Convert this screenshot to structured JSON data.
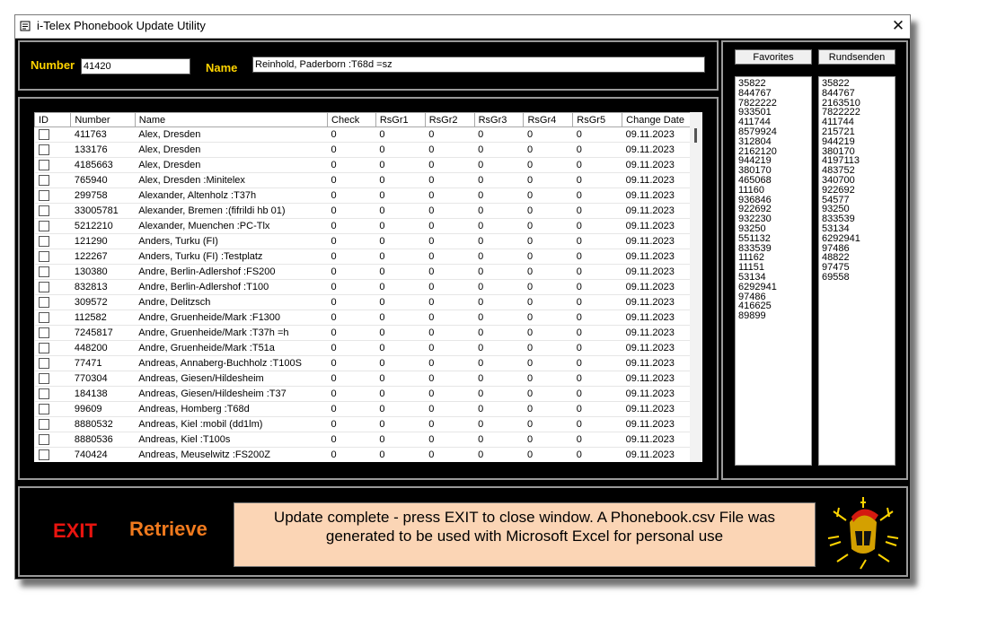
{
  "window": {
    "title": "i-Telex Phonebook Update Utility"
  },
  "top": {
    "number_label": "Number",
    "number_value": "41420",
    "name_label": "Name",
    "name_value": "Reinhold, Paderborn :T68d =sz"
  },
  "table": {
    "columns": [
      "ID",
      "Number",
      "Name",
      "Check",
      "RsGr1",
      "RsGr2",
      "RsGr3",
      "RsGr4",
      "RsGr5",
      "Change Date"
    ],
    "rows": [
      {
        "number": "411763",
        "name": "Alex, Dresden",
        "check": "0",
        "rs1": "0",
        "rs2": "0",
        "rs3": "0",
        "rs4": "0",
        "rs5": "0",
        "date": "09.11.2023"
      },
      {
        "number": "133176",
        "name": "Alex, Dresden",
        "check": "0",
        "rs1": "0",
        "rs2": "0",
        "rs3": "0",
        "rs4": "0",
        "rs5": "0",
        "date": "09.11.2023"
      },
      {
        "number": "4185663",
        "name": "Alex, Dresden",
        "check": "0",
        "rs1": "0",
        "rs2": "0",
        "rs3": "0",
        "rs4": "0",
        "rs5": "0",
        "date": "09.11.2023"
      },
      {
        "number": "765940",
        "name": "Alex, Dresden :Minitelex",
        "check": "0",
        "rs1": "0",
        "rs2": "0",
        "rs3": "0",
        "rs4": "0",
        "rs5": "0",
        "date": "09.11.2023"
      },
      {
        "number": "299758",
        "name": "Alexander, Altenholz :T37h",
        "check": "0",
        "rs1": "0",
        "rs2": "0",
        "rs3": "0",
        "rs4": "0",
        "rs5": "0",
        "date": "09.11.2023"
      },
      {
        "number": "33005781",
        "name": "Alexander, Bremen :(fifrildi hb 01)",
        "check": "0",
        "rs1": "0",
        "rs2": "0",
        "rs3": "0",
        "rs4": "0",
        "rs5": "0",
        "date": "09.11.2023"
      },
      {
        "number": "5212210",
        "name": "Alexander, Muenchen :PC-Tlx",
        "check": "0",
        "rs1": "0",
        "rs2": "0",
        "rs3": "0",
        "rs4": "0",
        "rs5": "0",
        "date": "09.11.2023"
      },
      {
        "number": "121290",
        "name": "Anders, Turku (FI)",
        "check": "0",
        "rs1": "0",
        "rs2": "0",
        "rs3": "0",
        "rs4": "0",
        "rs5": "0",
        "date": "09.11.2023"
      },
      {
        "number": "122267",
        "name": "Anders, Turku (FI) :Testplatz",
        "check": "0",
        "rs1": "0",
        "rs2": "0",
        "rs3": "0",
        "rs4": "0",
        "rs5": "0",
        "date": "09.11.2023"
      },
      {
        "number": "130380",
        "name": "Andre, Berlin-Adlershof :FS200",
        "check": "0",
        "rs1": "0",
        "rs2": "0",
        "rs3": "0",
        "rs4": "0",
        "rs5": "0",
        "date": "09.11.2023"
      },
      {
        "number": "832813",
        "name": "Andre, Berlin-Adlershof :T100",
        "check": "0",
        "rs1": "0",
        "rs2": "0",
        "rs3": "0",
        "rs4": "0",
        "rs5": "0",
        "date": "09.11.2023"
      },
      {
        "number": "309572",
        "name": "Andre, Delitzsch",
        "check": "0",
        "rs1": "0",
        "rs2": "0",
        "rs3": "0",
        "rs4": "0",
        "rs5": "0",
        "date": "09.11.2023"
      },
      {
        "number": "112582",
        "name": "Andre, Gruenheide/Mark :F1300",
        "check": "0",
        "rs1": "0",
        "rs2": "0",
        "rs3": "0",
        "rs4": "0",
        "rs5": "0",
        "date": "09.11.2023"
      },
      {
        "number": "7245817",
        "name": "Andre, Gruenheide/Mark :T37h =h",
        "check": "0",
        "rs1": "0",
        "rs2": "0",
        "rs3": "0",
        "rs4": "0",
        "rs5": "0",
        "date": "09.11.2023"
      },
      {
        "number": "448200",
        "name": "Andre, Gruenheide/Mark :T51a",
        "check": "0",
        "rs1": "0",
        "rs2": "0",
        "rs3": "0",
        "rs4": "0",
        "rs5": "0",
        "date": "09.11.2023"
      },
      {
        "number": "77471",
        "name": "Andreas, Annaberg-Buchholz :T100S",
        "check": "0",
        "rs1": "0",
        "rs2": "0",
        "rs3": "0",
        "rs4": "0",
        "rs5": "0",
        "date": "09.11.2023"
      },
      {
        "number": "770304",
        "name": "Andreas, Giesen/Hildesheim",
        "check": "0",
        "rs1": "0",
        "rs2": "0",
        "rs3": "0",
        "rs4": "0",
        "rs5": "0",
        "date": "09.11.2023"
      },
      {
        "number": "184138",
        "name": "Andreas, Giesen/Hildesheim :T37",
        "check": "0",
        "rs1": "0",
        "rs2": "0",
        "rs3": "0",
        "rs4": "0",
        "rs5": "0",
        "date": "09.11.2023"
      },
      {
        "number": "99609",
        "name": "Andreas, Homberg :T68d",
        "check": "0",
        "rs1": "0",
        "rs2": "0",
        "rs3": "0",
        "rs4": "0",
        "rs5": "0",
        "date": "09.11.2023"
      },
      {
        "number": "8880532",
        "name": "Andreas, Kiel :mobil (dd1lm)",
        "check": "0",
        "rs1": "0",
        "rs2": "0",
        "rs3": "0",
        "rs4": "0",
        "rs5": "0",
        "date": "09.11.2023"
      },
      {
        "number": "8880536",
        "name": "Andreas, Kiel :T100s",
        "check": "0",
        "rs1": "0",
        "rs2": "0",
        "rs3": "0",
        "rs4": "0",
        "rs5": "0",
        "date": "09.11.2023"
      },
      {
        "number": "740424",
        "name": "Andreas, Meuselwitz :FS200Z",
        "check": "0",
        "rs1": "0",
        "rs2": "0",
        "rs3": "0",
        "rs4": "0",
        "rs5": "0",
        "date": "09.11.2023"
      }
    ]
  },
  "favorites": {
    "label": "Favorites",
    "items": [
      "35822",
      "844767",
      "7822222",
      "933501",
      "411744",
      "8579924",
      "312804",
      "2162120",
      "944219",
      "380170",
      "465068",
      "11160",
      "936846",
      "922692",
      "932230",
      "93250",
      "551132",
      "833539",
      "11162",
      "11151",
      "53134",
      "6292941",
      "97486",
      "416625",
      "89899"
    ]
  },
  "rundsenden": {
    "label": "Rundsenden",
    "items": [
      "35822",
      "844767",
      "2163510",
      "7822222",
      "411744",
      "215721",
      "944219",
      "380170",
      "4197113",
      "483752",
      "340700",
      "922692",
      "54577",
      "93250",
      "833539",
      "53134",
      "6292941",
      "97486",
      "48822",
      "97475",
      "69558"
    ]
  },
  "bottom": {
    "exit_label": "EXIT",
    "retrieve_label": "Retrieve",
    "status": "Update complete - press EXIT to close window. A Phonebook.csv File was generated to be used with Microsoft Excel for personal use"
  },
  "colors": {
    "label_yellow": "#ffd400",
    "exit_red": "#e8140f",
    "retrieve_orange": "#f07a1e",
    "status_bg": "#fbd5b5"
  }
}
